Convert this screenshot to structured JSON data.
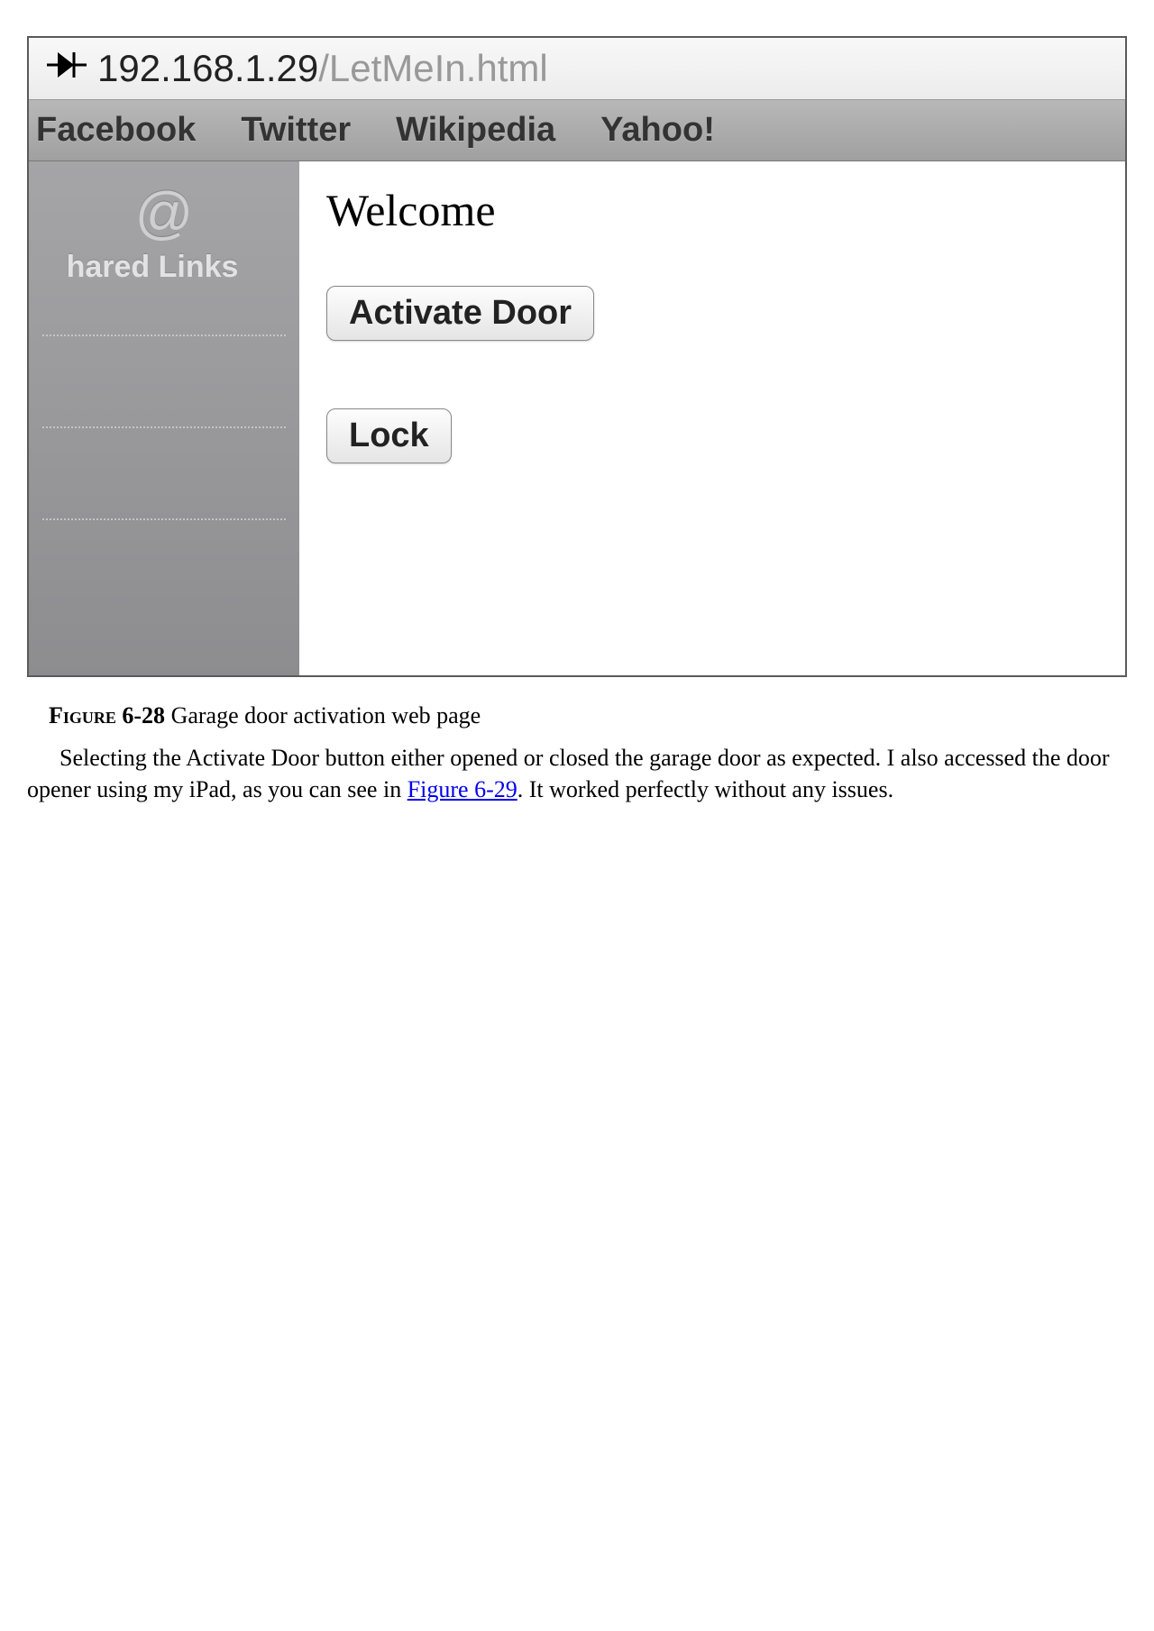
{
  "browser": {
    "url": {
      "host": "192.168.1.29",
      "path": "/LetMeIn.html"
    },
    "bookmarks": [
      "Facebook",
      "Twitter",
      "Wikipedia",
      "Yahoo!"
    ],
    "sidebar": {
      "icon_label": "@",
      "label": "hared Links"
    }
  },
  "page": {
    "heading": "Welcome",
    "buttons": {
      "activate": "Activate Door",
      "lock": "Lock"
    }
  },
  "caption": {
    "label": "Figure 6-28",
    "text": " Garage door activation web page"
  },
  "paragraph": {
    "part1": "Selecting the Activate Door button either opened or closed the garage door as expected. I also accessed the door opener using my iPad, as you can see in ",
    "link": "Figure 6-29",
    "part2": ". It worked perfectly without any issues."
  }
}
